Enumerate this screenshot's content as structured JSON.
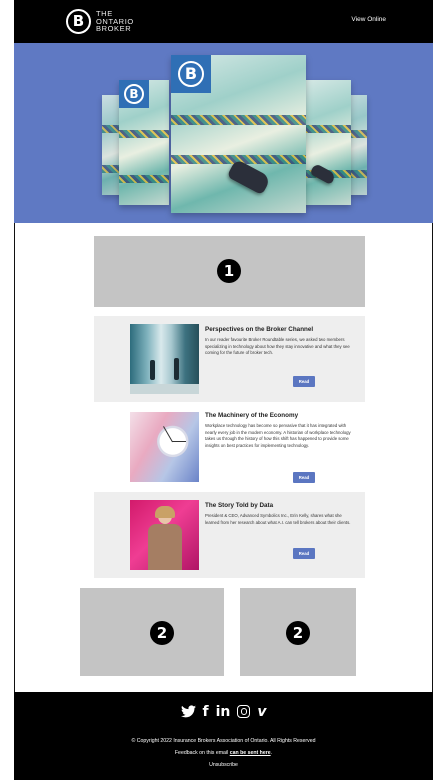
{
  "header": {
    "logo_line1": "THE",
    "logo_line2": "ONTARIO",
    "logo_line3": "BROKER",
    "logo_letter": "B",
    "view_online": "View Online"
  },
  "hero": {
    "background_color": "#5f79c3",
    "badge_letter": "B"
  },
  "placeholder_top": {
    "number": "1",
    "color": "#c4c4c4"
  },
  "articles": [
    {
      "title": "Perspectives on the Broker Channel",
      "body": "In our reader favourite Broker Roundtable series, we asked two members specializing in technology about how they stay innovative and what they see coming for the future of broker tech.",
      "button": "Read"
    },
    {
      "title": "The Machinery of the Economy",
      "body": "Workplace technology has become so pervasive that it has integrated with nearly every job in the modern economy. A historian of workplace technology takes us through the history of how this shift has happened to provide some insights on best practices for implementing technology.",
      "button": "Read"
    },
    {
      "title": "The Story Told by Data",
      "body": "President & CEO, Advanced Symbolics Inc., Erin Kelly, shares what she learned from her research about what A.I. can tell brokers about their clients.",
      "button": "Read"
    }
  ],
  "placeholders_bottom": [
    {
      "number": "2"
    },
    {
      "number": "2"
    }
  ],
  "footer": {
    "socials": [
      {
        "icon": "twitter-icon",
        "glyph": "🐦︎"
      },
      {
        "icon": "facebook-icon",
        "glyph": "f"
      },
      {
        "icon": "linkedin-icon",
        "glyph": "in"
      },
      {
        "icon": "instagram-icon",
        "glyph": ""
      },
      {
        "icon": "vimeo-icon",
        "glyph": "v"
      }
    ],
    "copyright": "© Copyright 2022 Insurance Brokers Association of Ontario. All Rights Reserved",
    "feedback_prefix": "Feedback on this email ",
    "feedback_link": "can be sent here",
    "feedback_suffix": ".",
    "unsubscribe": "Unsubscribe"
  },
  "colors": {
    "accent": "#5b76c1",
    "header_bg": "#000000",
    "article_bg_alt": "#eeeeee"
  }
}
